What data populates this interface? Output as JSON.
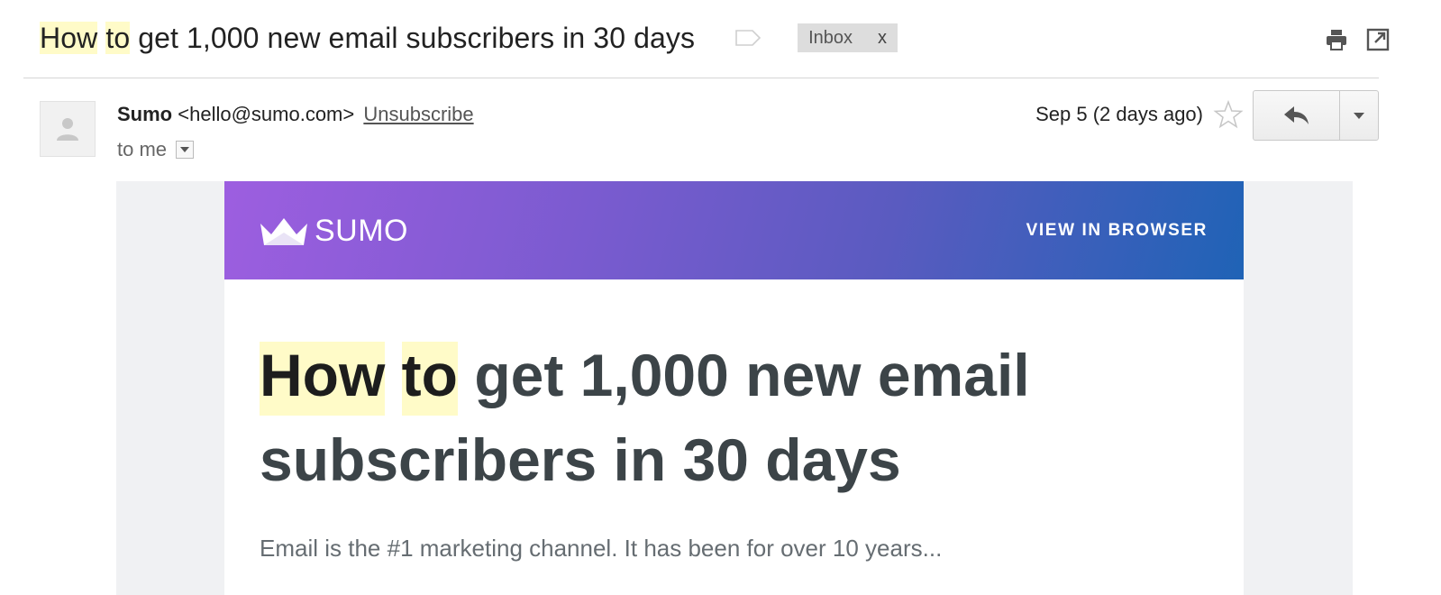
{
  "subject": {
    "word1": "How",
    "word2": "to",
    "rest": "get 1,000 new email subscribers in 30 days"
  },
  "labels": {
    "inbox_label": "Inbox",
    "remove_label": "x"
  },
  "icons": {
    "label_tag": "label-tag-icon",
    "print": "print-icon",
    "new_window": "new-window-icon",
    "avatar": "person-icon",
    "star": "star-icon",
    "reply": "reply-icon",
    "more": "caret-down-icon",
    "logo": "crown-icon"
  },
  "message": {
    "sender_name": "Sumo",
    "sender_email": "<hello@sumo.com>",
    "unsubscribe": "Unsubscribe",
    "to": "to me",
    "date": "Sep 5 (2 days ago)"
  },
  "email": {
    "brand": "SUMO",
    "view_in_browser": "VIEW IN BROWSER",
    "headline_word1": "How",
    "headline_word2": "to",
    "headline_line1_rest": "get 1,000 new email",
    "headline_line2": "subscribers in 30 days",
    "lede": "Email is the #1 marketing channel. It has been for over 10 years..."
  },
  "colors": {
    "highlight": "#fffbc8",
    "banner_start": "#9d5ee0",
    "banner_end": "#1f63b6",
    "headline": "#3c4448"
  }
}
